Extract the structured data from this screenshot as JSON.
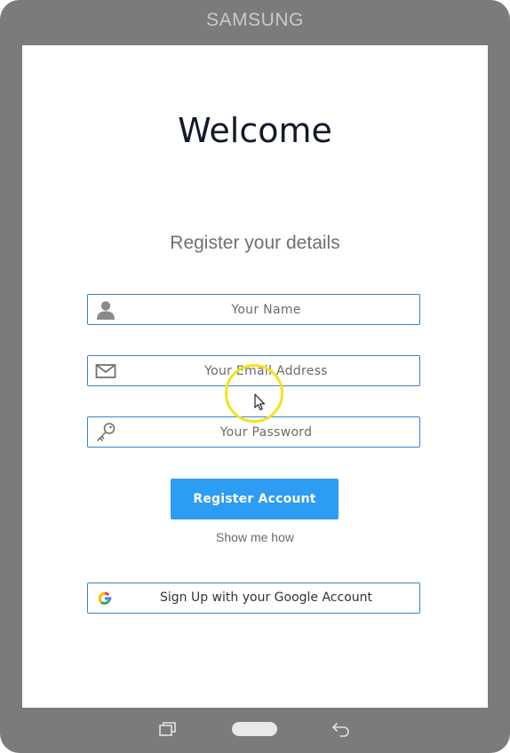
{
  "device": {
    "brand": "SAMSUNG"
  },
  "page": {
    "title": "Welcome",
    "subtitle": "Register your details"
  },
  "form": {
    "name_placeholder": "Your Name",
    "email_placeholder": "Your Email Address",
    "password_placeholder": "Your Password",
    "name_icon": "user-icon",
    "email_icon": "envelope-icon",
    "password_icon": "key-icon"
  },
  "actions": {
    "register_label": "Register Account",
    "show_me_how": "Show me how",
    "google_label": "Sign Up with your Google Account",
    "google_icon": "google-logo-icon"
  },
  "navbar": {
    "recent_icon": "recent-apps-icon",
    "home_icon": "home-button",
    "back_icon": "back-icon"
  },
  "colors": {
    "field_border": "#3b82c6",
    "primary_button": "#2d9cf3",
    "cursor_highlight": "#f2e21e",
    "device_frame": "#7b7b7b"
  }
}
